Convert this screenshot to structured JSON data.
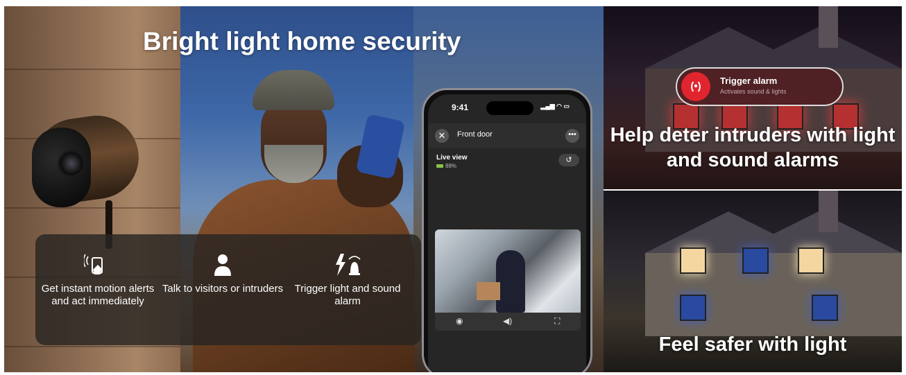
{
  "headline": "Bright light home security",
  "features": [
    {
      "icon": "motion-phone-icon",
      "text": "Get instant motion alerts and act immediately"
    },
    {
      "icon": "person-icon",
      "text": "Talk to visitors or intruders"
    },
    {
      "icon": "light-alarm-icon",
      "text": "Trigger light and sound alarm"
    }
  ],
  "phone": {
    "time": "9:41",
    "title": "Front door",
    "live_view": "Live view",
    "battery": "88%",
    "controls": [
      "camera-icon",
      "speaker-icon",
      "fullscreen-icon"
    ]
  },
  "alarm": {
    "title": "Trigger alarm",
    "subtitle": "Activates sound & lights",
    "color": "#e0252e"
  },
  "captions": {
    "top": "Help deter intruders with light and sound alarms",
    "bottom": "Feel safer with light"
  }
}
